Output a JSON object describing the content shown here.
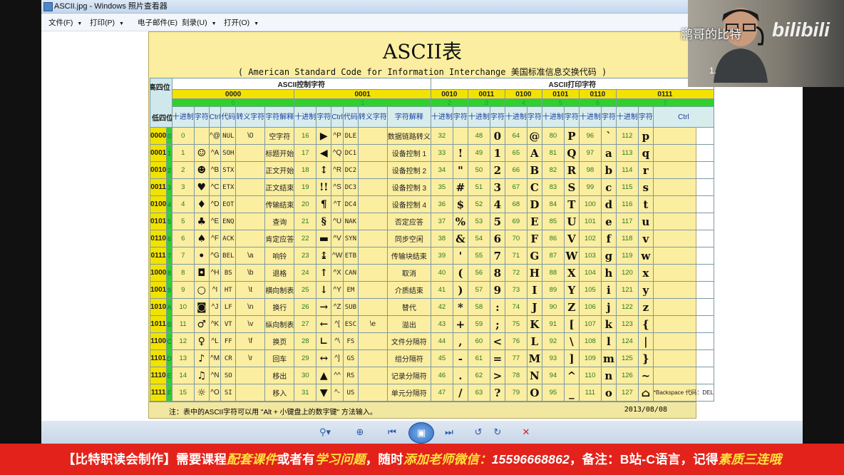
{
  "window": {
    "title": "ASCII.jpg - Windows 照片查看器",
    "menu": [
      {
        "label": "文件(F)",
        "arrow": "▼"
      },
      {
        "label": "打印(P)",
        "arrow": "▼"
      },
      {
        "label": "电子邮件(E)",
        "arrow": ""
      },
      {
        "label": "刻录(U)",
        "arrow": "▼"
      },
      {
        "label": "打开(O)",
        "arrow": "▼"
      }
    ]
  },
  "poster": {
    "title": "ASCII表",
    "subtitle": "( American Standard Code for Information Interchange  美国标准信息交换代码 )",
    "corner_high": "高四位",
    "corner_low": "低四位",
    "group_control": "ASCII控制字符",
    "group_print": "ASCII打印字符",
    "high_bits": [
      "0000",
      "0001",
      "0010",
      "0011",
      "0100",
      "0101",
      "0110",
      "0111"
    ],
    "high_hex": [
      "0",
      "1",
      "2",
      "3",
      "4",
      "5",
      "6",
      "7"
    ],
    "control_headers": [
      "十进制",
      "字符",
      "Ctrl",
      "代码",
      "转义字符",
      "字符解释"
    ],
    "print_headers": [
      "十进制",
      "字符"
    ],
    "last_header": "Ctrl",
    "rows": [
      {
        "bin": "0000",
        "hex": "0",
        "c0": [
          "0",
          "",
          "^@",
          "NUL",
          "\\0",
          "空字符"
        ],
        "c1": [
          "16",
          "▶",
          "^P",
          "DLE",
          "",
          "数据链路转义"
        ],
        "p": [
          "32",
          "",
          "48",
          "0",
          "64",
          "@",
          "80",
          "P",
          "96",
          "`",
          "112",
          "p"
        ],
        "last": ""
      },
      {
        "bin": "0001",
        "hex": "1",
        "c0": [
          "1",
          "☺",
          "^A",
          "SOH",
          "",
          "标题开始"
        ],
        "c1": [
          "17",
          "◀",
          "^Q",
          "DC1",
          "",
          "设备控制 1"
        ],
        "p": [
          "33",
          "!",
          "49",
          "1",
          "65",
          "A",
          "81",
          "Q",
          "97",
          "a",
          "113",
          "q"
        ],
        "last": ""
      },
      {
        "bin": "0010",
        "hex": "2",
        "c0": [
          "2",
          "☻",
          "^B",
          "STX",
          "",
          "正文开始"
        ],
        "c1": [
          "18",
          "↕",
          "^R",
          "DC2",
          "",
          "设备控制 2"
        ],
        "p": [
          "34",
          "\"",
          "50",
          "2",
          "66",
          "B",
          "82",
          "R",
          "98",
          "b",
          "114",
          "r"
        ],
        "last": ""
      },
      {
        "bin": "0011",
        "hex": "3",
        "c0": [
          "3",
          "♥",
          "^C",
          "ETX",
          "",
          "正文结束"
        ],
        "c1": [
          "19",
          "!!",
          "^S",
          "DC3",
          "",
          "设备控制 3"
        ],
        "p": [
          "35",
          "#",
          "51",
          "3",
          "67",
          "C",
          "83",
          "S",
          "99",
          "c",
          "115",
          "s"
        ],
        "last": ""
      },
      {
        "bin": "0100",
        "hex": "4",
        "c0": [
          "4",
          "♦",
          "^D",
          "EOT",
          "",
          "传输结束"
        ],
        "c1": [
          "20",
          "¶",
          "^T",
          "DC4",
          "",
          "设备控制 4"
        ],
        "p": [
          "36",
          "$",
          "52",
          "4",
          "68",
          "D",
          "84",
          "T",
          "100",
          "d",
          "116",
          "t"
        ],
        "last": ""
      },
      {
        "bin": "0101",
        "hex": "5",
        "c0": [
          "5",
          "♣",
          "^E",
          "ENQ",
          "",
          "查询"
        ],
        "c1": [
          "21",
          "§",
          "^U",
          "NAK",
          "",
          "否定应答"
        ],
        "p": [
          "37",
          "%",
          "53",
          "5",
          "69",
          "E",
          "85",
          "U",
          "101",
          "e",
          "117",
          "u"
        ],
        "last": ""
      },
      {
        "bin": "0110",
        "hex": "6",
        "c0": [
          "6",
          "♠",
          "^F",
          "ACK",
          "",
          "肯定应答"
        ],
        "c1": [
          "22",
          "▬",
          "^V",
          "SYN",
          "",
          "同步空闲"
        ],
        "p": [
          "38",
          "&",
          "54",
          "6",
          "70",
          "F",
          "86",
          "V",
          "102",
          "f",
          "118",
          "v"
        ],
        "last": ""
      },
      {
        "bin": "0111",
        "hex": "7",
        "c0": [
          "7",
          "•",
          "^G",
          "BEL",
          "\\a",
          "响铃"
        ],
        "c1": [
          "23",
          "↨",
          "^W",
          "ETB",
          "",
          "传输块结束"
        ],
        "p": [
          "39",
          "'",
          "55",
          "7",
          "71",
          "G",
          "87",
          "W",
          "103",
          "g",
          "119",
          "w"
        ],
        "last": ""
      },
      {
        "bin": "1000",
        "hex": "8",
        "c0": [
          "8",
          "◘",
          "^H",
          "BS",
          "\\b",
          "退格"
        ],
        "c1": [
          "24",
          "↑",
          "^X",
          "CAN",
          "",
          "取消"
        ],
        "p": [
          "40",
          "(",
          "56",
          "8",
          "72",
          "H",
          "88",
          "X",
          "104",
          "h",
          "120",
          "x"
        ],
        "last": ""
      },
      {
        "bin": "1001",
        "hex": "9",
        "c0": [
          "9",
          "○",
          "^I",
          "HT",
          "\\t",
          "横向制表"
        ],
        "c1": [
          "25",
          "↓",
          "^Y",
          "EM",
          "",
          "介质结束"
        ],
        "p": [
          "41",
          ")",
          "57",
          "9",
          "73",
          "I",
          "89",
          "Y",
          "105",
          "i",
          "121",
          "y"
        ],
        "last": ""
      },
      {
        "bin": "1010",
        "hex": "A",
        "c0": [
          "10",
          "◙",
          "^J",
          "LF",
          "\\n",
          "换行"
        ],
        "c1": [
          "26",
          "→",
          "^Z",
          "SUB",
          "",
          "替代"
        ],
        "p": [
          "42",
          "*",
          "58",
          ":",
          "74",
          "J",
          "90",
          "Z",
          "106",
          "j",
          "122",
          "z"
        ],
        "last": ""
      },
      {
        "bin": "1011",
        "hex": "B",
        "c0": [
          "11",
          "♂",
          "^K",
          "VT",
          "\\v",
          "纵向制表"
        ],
        "c1": [
          "27",
          "←",
          "^[",
          "ESC",
          "\\e",
          "溢出"
        ],
        "p": [
          "43",
          "+",
          "59",
          ";",
          "75",
          "K",
          "91",
          "[",
          "107",
          "k",
          "123",
          "{"
        ],
        "last": ""
      },
      {
        "bin": "1100",
        "hex": "C",
        "c0": [
          "12",
          "♀",
          "^L",
          "FF",
          "\\f",
          "换页"
        ],
        "c1": [
          "28",
          "∟",
          "^\\",
          "FS",
          "",
          "文件分隔符"
        ],
        "p": [
          "44",
          ",",
          "60",
          "<",
          "76",
          "L",
          "92",
          "\\",
          "108",
          "l",
          "124",
          "|"
        ],
        "last": ""
      },
      {
        "bin": "1101",
        "hex": "D",
        "c0": [
          "13",
          "♪",
          "^M",
          "CR",
          "\\r",
          "回车"
        ],
        "c1": [
          "29",
          "↔",
          "^]",
          "GS",
          "",
          "组分隔符"
        ],
        "p": [
          "45",
          "-",
          "61",
          "=",
          "77",
          "M",
          "93",
          "]",
          "109",
          "m",
          "125",
          "}"
        ],
        "last": ""
      },
      {
        "bin": "1110",
        "hex": "E",
        "c0": [
          "14",
          "♫",
          "^N",
          "SO",
          "",
          "移出"
        ],
        "c1": [
          "30",
          "▲",
          "^^",
          "RS",
          "",
          "记录分隔符"
        ],
        "p": [
          "46",
          ".",
          "62",
          ">",
          "78",
          "N",
          "94",
          "^",
          "110",
          "n",
          "126",
          "~"
        ],
        "last": ""
      },
      {
        "bin": "1111",
        "hex": "F",
        "c0": [
          "15",
          "☼",
          "^O",
          "SI",
          "",
          "移入"
        ],
        "c1": [
          "31",
          "▼",
          "^-",
          "US",
          "",
          "单元分隔符"
        ],
        "p": [
          "47",
          "/",
          "63",
          "?",
          "79",
          "O",
          "95",
          "_",
          "111",
          "o",
          "127",
          "⌂"
        ],
        "last": "*Backspace 代码：DEL"
      }
    ],
    "footer_note": "注：表中的ASCII字符可以用 \"Alt + 小键盘上的数字键\" 方法输入。",
    "footer_date": "2013/08/08"
  },
  "toolbar": {
    "buttons": [
      {
        "name": "zoom-button",
        "icon": "⚲▾"
      },
      {
        "name": "fit-button",
        "icon": "⊕"
      },
      {
        "name": "previous-button",
        "icon": "⏮"
      },
      {
        "name": "slideshow-button",
        "icon": "▣"
      },
      {
        "name": "next-button",
        "icon": "⏭"
      },
      {
        "name": "rotate-left-button",
        "icon": "↺"
      },
      {
        "name": "rotate-right-button",
        "icon": "↻"
      },
      {
        "name": "delete-button",
        "icon": "✕"
      }
    ]
  },
  "webcam": {
    "watermark": "鹏哥的比特",
    "logo": "bilibili",
    "dot": "1."
  },
  "banner": {
    "p1": "【比特职读会制作】需要课程",
    "y1": "配套课件",
    "p2": "或者有",
    "y2": "学习问题",
    "p3": "，随时",
    "y3": "添加老师微信：",
    "phone": "15596668862",
    "p4": "，备注：B站-C语言，记得",
    "y4": "素质三连哦"
  },
  "colors": {
    "poster_bg": "#fbeea0",
    "bits_yellow": "#f2e200",
    "hex_green": "#2ed12e",
    "banner_red": "#e3231b",
    "banner_highlight": "#ffe23b"
  }
}
